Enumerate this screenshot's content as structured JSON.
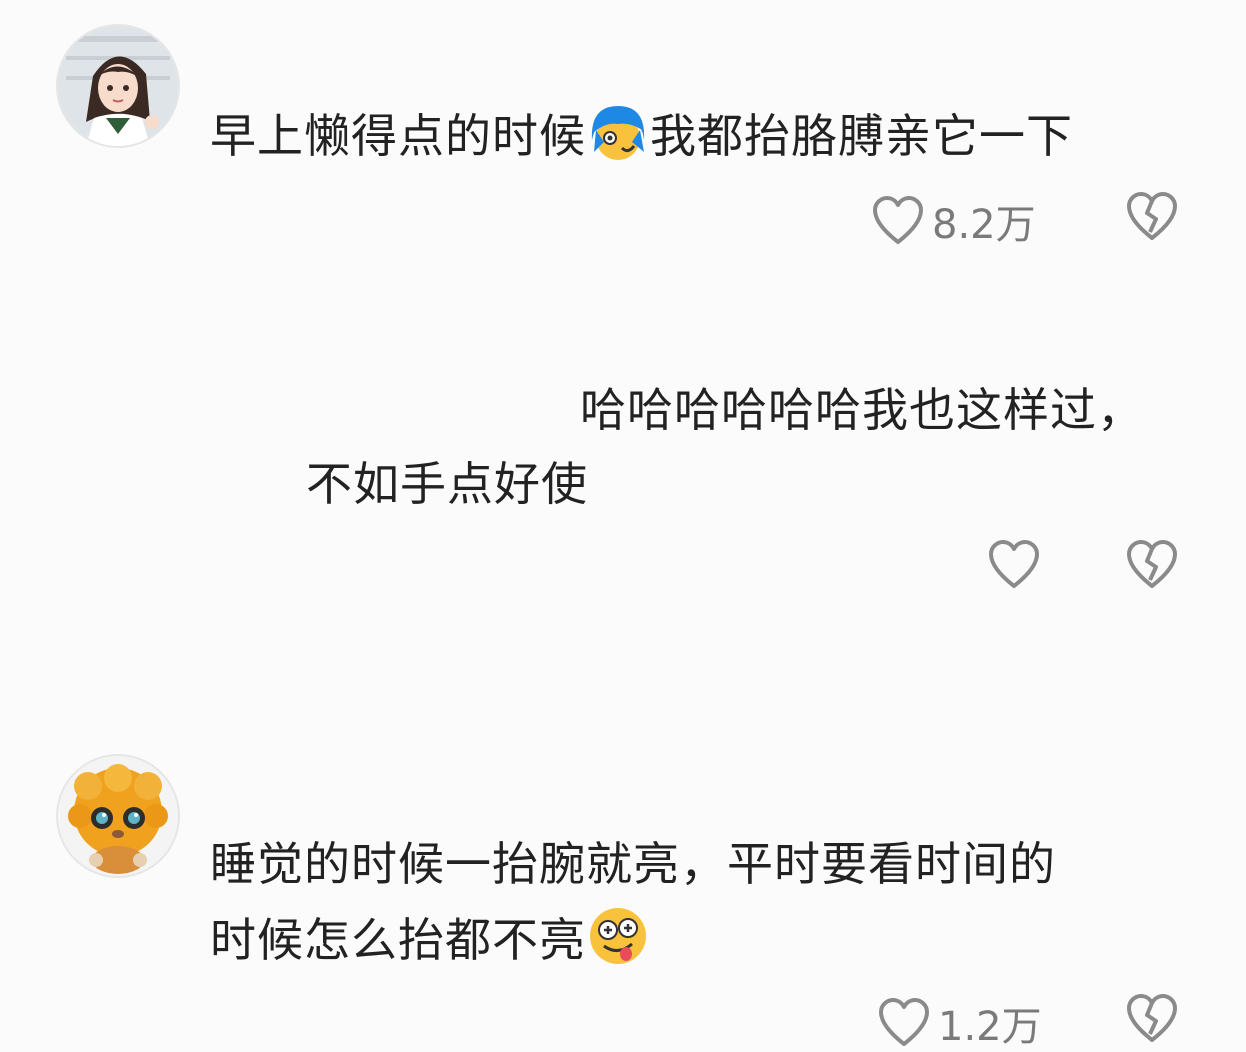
{
  "comments": [
    {
      "avatar_icon": "anime-girl-avatar",
      "text_part1": "早上懒得点的时候",
      "emoji": "blue-hair-emoji",
      "text_part2": "我都抬胳膊亲它一下",
      "likes": "8.2万"
    },
    {
      "line1": "哈哈哈哈哈哈我也这样过，",
      "line2": "不如手点好使",
      "likes": ""
    },
    {
      "avatar_icon": "orange-fluffy-creature-avatar",
      "line1": "睡觉的时候一抬腕就亮，平时要看时间的",
      "line2": "时候怎么抬都不亮",
      "emoji": "goofy-dizzy-face-emoji",
      "likes": "1.2万"
    }
  ],
  "colors": {
    "background": "#fbfbfb",
    "text": "#222222",
    "icon": "#8a8a8a",
    "count": "#7a7a7a"
  }
}
